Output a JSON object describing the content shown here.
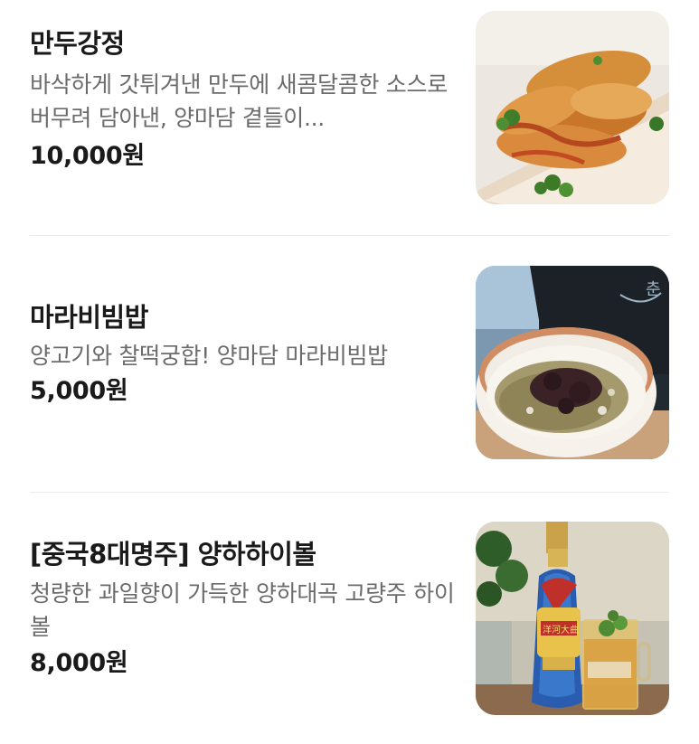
{
  "menu": {
    "items": [
      {
        "name": "만두강정",
        "description": "바삭하게 갓튀겨낸 만두에 새콤달콤한 소스로 버무려 담아낸, 양마담 곁들이...",
        "price": "10,000원",
        "image_icon": "fried-dumpling-photo"
      },
      {
        "name": "마라비빔밥",
        "description": "양고기와 찰떡궁합! 양마담 마라비빔밥",
        "price": "5,000원",
        "image_icon": "mala-bibimbap-photo"
      },
      {
        "name": "[중국8대명주] 양하하이볼",
        "description": "청량한 과일향이 가득한 양하대곡 고량주 하이볼",
        "price": "8,000원",
        "image_icon": "highball-bottle-photo"
      }
    ]
  },
  "colors": {
    "text_primary": "#1a1a1a",
    "text_secondary": "#6b6b6b",
    "divider": "#ececec"
  }
}
